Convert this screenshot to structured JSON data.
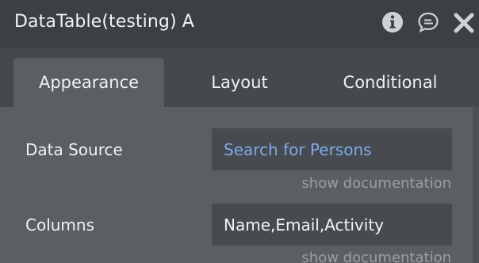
{
  "header": {
    "title": "DataTable(testing) A",
    "icons": [
      "info-icon",
      "comment-icon",
      "close-icon"
    ]
  },
  "tabs": [
    {
      "label": "Appearance",
      "active": true
    },
    {
      "label": "Layout",
      "active": false
    },
    {
      "label": "Conditional",
      "active": false
    }
  ],
  "fields": [
    {
      "label": "Data Source",
      "value": "Search for Persons",
      "doc_link": "show documentation"
    },
    {
      "label": "Columns",
      "value": "Name,Email,Activity",
      "doc_link": "show documentation"
    }
  ],
  "colors": {
    "header_bg": "#3b4045",
    "tabbar_bg": "#45494e",
    "panel_bg": "#5b5f63",
    "input_bg": "#474b50",
    "link_blue": "#7fa9e8",
    "muted_text": "#9a9ea3"
  }
}
